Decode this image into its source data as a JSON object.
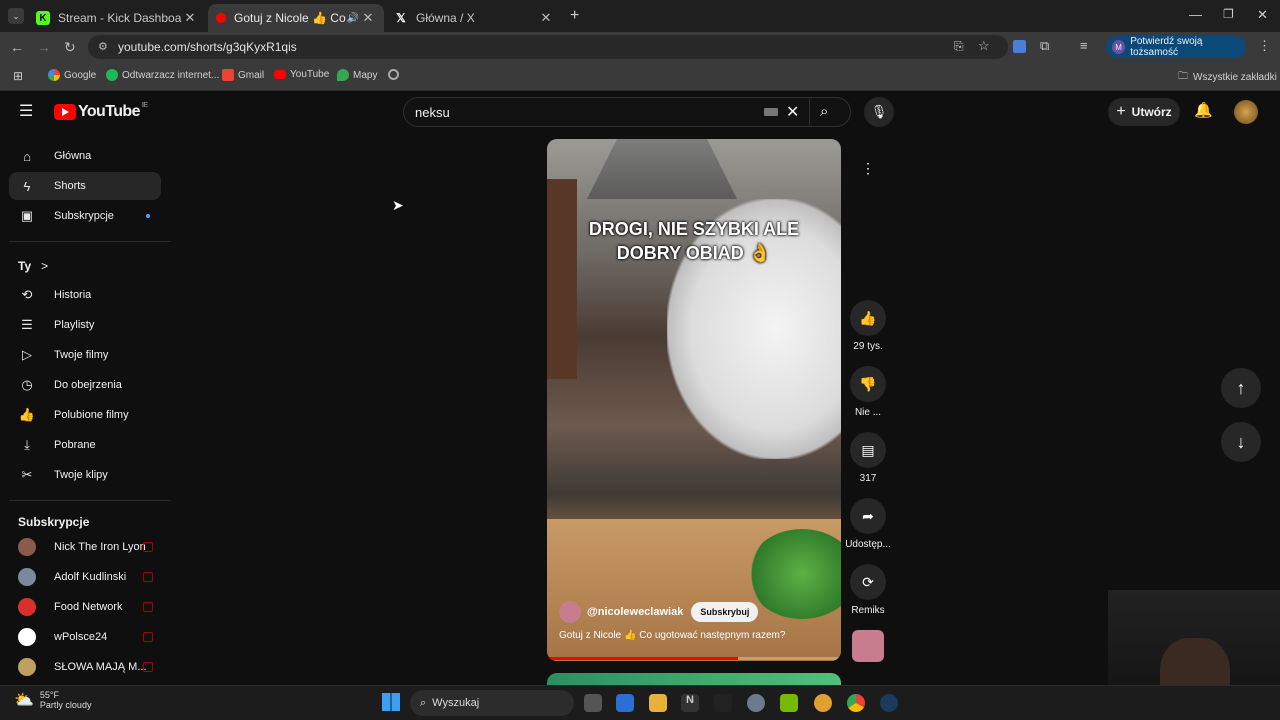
{
  "browser": {
    "tabs": [
      {
        "title": "Stream - Kick Dashboard",
        "active": false
      },
      {
        "title": "Gotuj z Nicole 👍 Co ugotować następnym razem?",
        "active": true
      },
      {
        "title": "Główna / X",
        "active": false
      }
    ],
    "url": "youtube.com/shorts/g3qKyxR1qis",
    "verify_label": "Potwierdź swoją tożsamość",
    "bookmarks": [
      "Google",
      "Odtwarzacz internet...",
      "Gmail",
      "YouTube",
      "Mapy"
    ],
    "all_bookmarks": "Wszystkie zakładki"
  },
  "youtube": {
    "logo": "YouTube",
    "logo_region": "IE",
    "search_value": "neksu",
    "create_label": "Utwórz",
    "sidebar": {
      "main": [
        {
          "label": "Główna",
          "icon": "home-icon"
        },
        {
          "label": "Shorts",
          "icon": "shorts-icon",
          "active": true
        },
        {
          "label": "Subskrypcje",
          "icon": "subscriptions-icon"
        }
      ],
      "you_header": "Ty",
      "you_chevron": ">",
      "you": [
        {
          "label": "Historia",
          "icon": "history-icon"
        },
        {
          "label": "Playlisty",
          "icon": "playlist-icon"
        },
        {
          "label": "Twoje filmy",
          "icon": "your-videos-icon"
        },
        {
          "label": "Do obejrzenia",
          "icon": "watch-later-icon"
        },
        {
          "label": "Polubione filmy",
          "icon": "liked-icon"
        },
        {
          "label": "Pobrane",
          "icon": "download-icon"
        },
        {
          "label": "Twoje klipy",
          "icon": "clips-icon"
        }
      ],
      "subs_header": "Subskrypcje",
      "subs": [
        {
          "label": "Nick The Iron Lyon",
          "color": "#8a5a4a"
        },
        {
          "label": "Adolf Kudlinski",
          "color": "#7a8a9a"
        },
        {
          "label": "Food Network",
          "color": "#d9302c"
        },
        {
          "label": "wPolsce24",
          "color": "#ffffff"
        },
        {
          "label": "SŁOWA MAJĄ M...",
          "color": "#c0a060"
        }
      ]
    },
    "short": {
      "overlay_line1": "DROGI, NIE SZYBKI ALE",
      "overlay_line2": "DOBRY OBIAD 👌",
      "channel": "@nicoleweclawiak",
      "subscribe": "Subskrybuj",
      "caption": "Gotuj z Nicole 👍 Co ugotować następnym razem?",
      "progress": 0.65
    },
    "actions": {
      "likes": "29 tys.",
      "dislike": "Nie ...",
      "comments": "317",
      "share": "Udostęp...",
      "remix": "Remiks"
    }
  },
  "taskbar": {
    "temp": "55°F",
    "condition": "Partly cloudy",
    "search": "Wyszukaj"
  }
}
